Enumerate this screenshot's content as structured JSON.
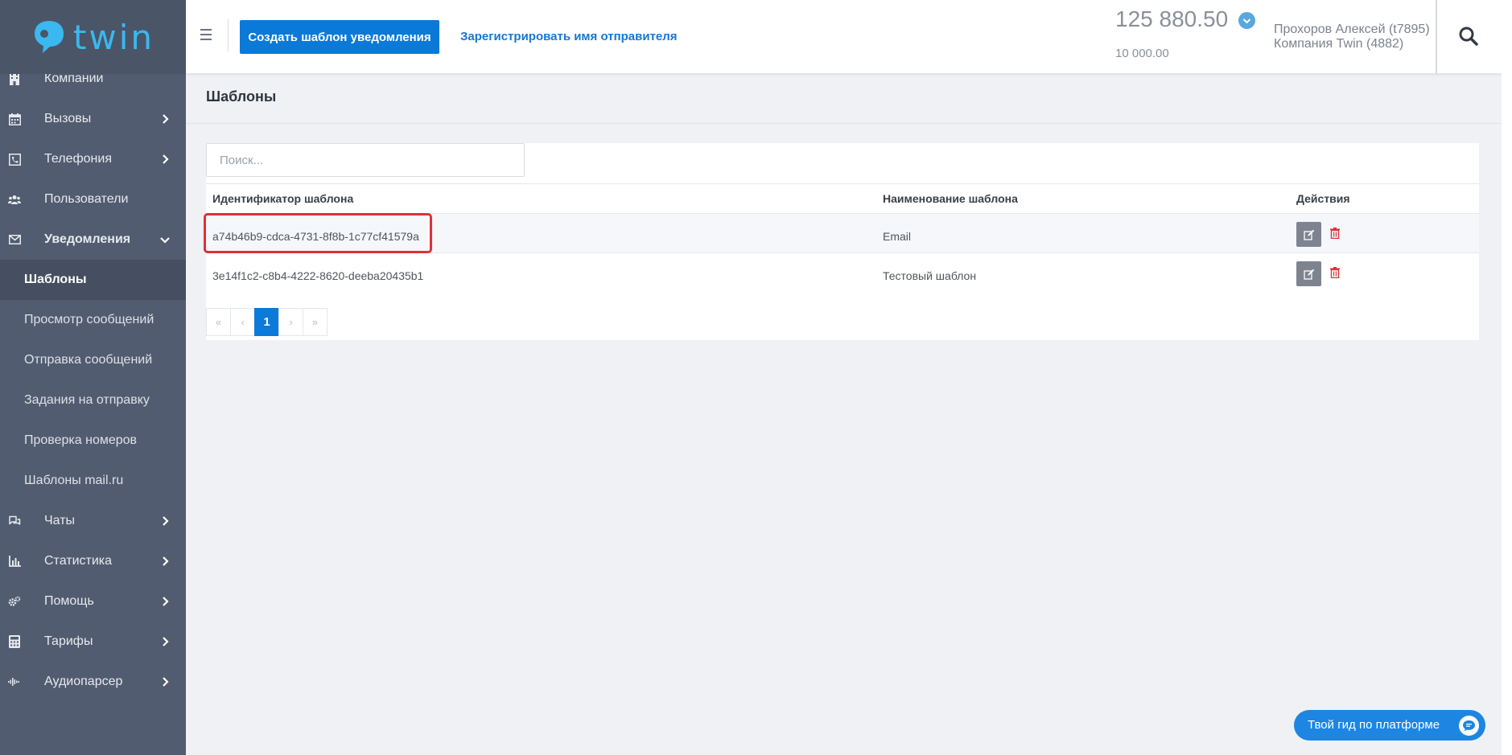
{
  "brand": {
    "logo_text": "twin",
    "logo_color": "#3ab8f0"
  },
  "sidebar": {
    "items": [
      {
        "label": "Компании",
        "icon": "building-icon",
        "has_children": false
      },
      {
        "label": "Вызовы",
        "icon": "calendar-icon",
        "has_children": true
      },
      {
        "label": "Телефония",
        "icon": "phone-icon",
        "has_children": true
      },
      {
        "label": "Пользователи",
        "icon": "users-icon",
        "has_children": false
      },
      {
        "label": "Уведомления",
        "icon": "envelope-icon",
        "has_children": true,
        "expanded": true
      }
    ],
    "subitems": [
      {
        "label": "Шаблоны",
        "active": true
      },
      {
        "label": "Просмотр сообщений"
      },
      {
        "label": "Отправка сообщений"
      },
      {
        "label": "Задания на отправку"
      },
      {
        "label": "Проверка номеров"
      },
      {
        "label": "Шаблоны mail.ru"
      }
    ],
    "items_after": [
      {
        "label": "Чаты",
        "icon": "chat-icon",
        "has_children": true
      },
      {
        "label": "Статистика",
        "icon": "bar-chart-icon",
        "has_children": true
      },
      {
        "label": "Помощь",
        "icon": "gears-icon",
        "has_children": true
      },
      {
        "label": "Тарифы",
        "icon": "calculator-icon",
        "has_children": true
      },
      {
        "label": "Аудиопарсер",
        "icon": "waveform-icon",
        "has_children": true
      }
    ]
  },
  "header": {
    "create_template_label": "Создать шаблон уведомления",
    "register_sender_label": "Зарегистрировать имя отправителя",
    "balance": "125 880.50",
    "credit": "10 000.00",
    "user_name": "Прохоров Алексей (t7895)",
    "company_name": "Компания Twin (4882)"
  },
  "page": {
    "title": "Шаблоны"
  },
  "search": {
    "placeholder": "Поиск..."
  },
  "table": {
    "headers": [
      "Идентификатор шаблона",
      "Наименование шаблона",
      "Действия"
    ],
    "rows": [
      {
        "id": "a74b46b9-cdca-4731-8f8b-1c77cf41579a",
        "name": "Email"
      },
      {
        "id": "3e14f1c2-c8b4-4222-8620-deeba20435b1",
        "name": "Тестовый шаблон"
      }
    ]
  },
  "pagination": {
    "first": "«",
    "prev": "‹",
    "current": "1",
    "next": "›",
    "last": "»"
  },
  "guide": {
    "label": "Твой гид по платформе"
  },
  "colors": {
    "sidebar_bg": "#515c70",
    "primary": "#0b79d8",
    "highlight": "#e0303a",
    "delete": "#e0303a"
  }
}
